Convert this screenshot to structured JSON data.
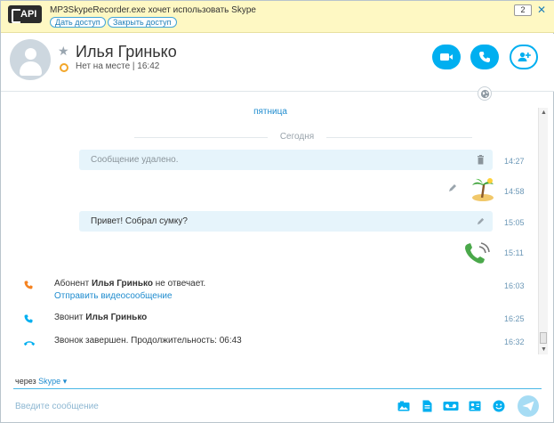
{
  "notification": {
    "badge": "API",
    "message": "MP3SkypeRecorder.exe хочет использовать Skype",
    "allow_label": "Дать доступ",
    "deny_label": "Закрыть доступ",
    "count": "2"
  },
  "contact": {
    "name": "Илья Гринько",
    "status": "Нет на месте | 16:42"
  },
  "header_buttons": {
    "video": "video-call-icon",
    "call": "phone-icon",
    "add": "add-contact-icon"
  },
  "chat": {
    "day_link": "пятница",
    "today_label": "Сегодня",
    "messages": [
      {
        "text": "Сообщение удалено.",
        "time": "14:27"
      },
      {
        "text": "",
        "time": "14:58"
      },
      {
        "text": "Привет! Собрал сумку?",
        "time": "15:05"
      },
      {
        "text": "",
        "time": "15:11"
      }
    ],
    "events": [
      {
        "prefix": "Абонент ",
        "name": "Илья Гринько",
        "suffix": " не отвечает.",
        "link": "Отправить видеосообщение",
        "time": "16:03"
      },
      {
        "prefix": "Звонит ",
        "name": "Илья Гринько",
        "time": "16:25"
      },
      {
        "text": "Звонок завершен. Продолжительность: 06:43",
        "time": "16:32"
      }
    ]
  },
  "compose": {
    "via_prefix": "через",
    "via_service": "Skype",
    "placeholder": "Введите сообщение"
  },
  "colors": {
    "accent": "#00aff0",
    "bubble": "#e6f4fb",
    "missed_call": "#f58220",
    "notification_bg": "#fef8c3"
  }
}
